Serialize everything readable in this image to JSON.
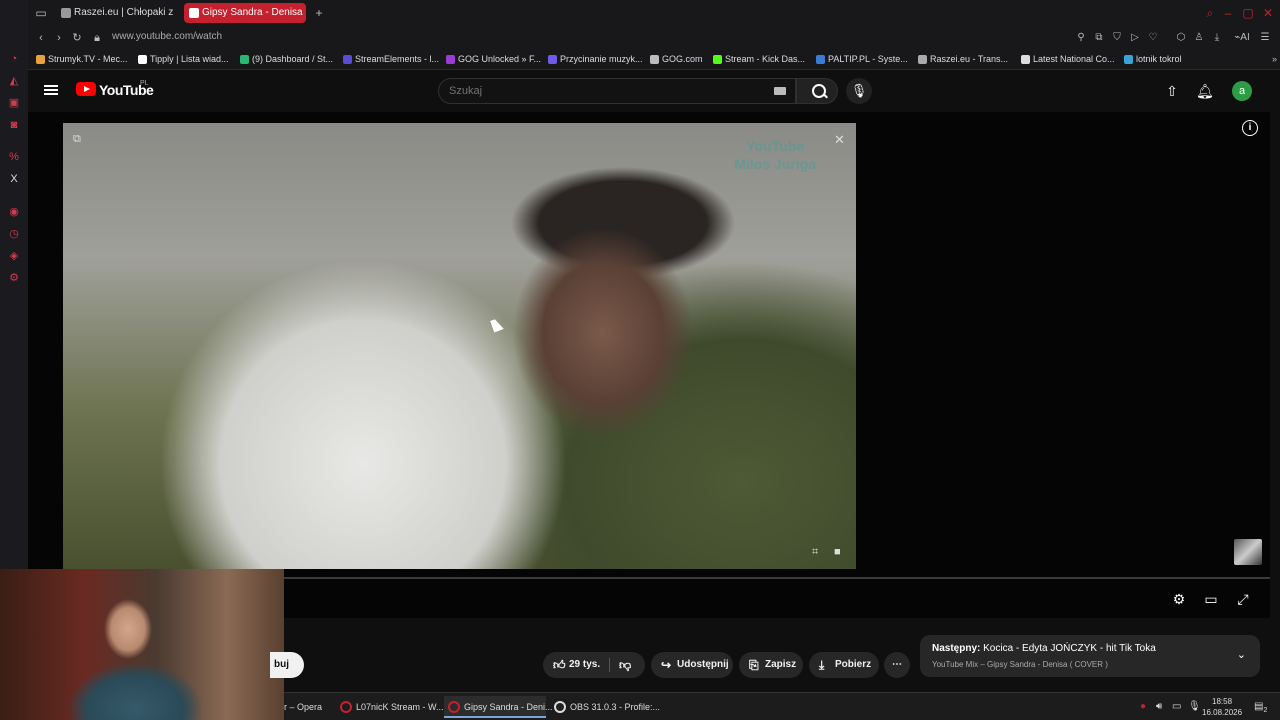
{
  "browser": {
    "tabs": [
      {
        "label": "Raszei.eu | Chłopaki z",
        "active": false
      },
      {
        "label": "Gipsy Sandra - Denisa ( CO",
        "active": true
      }
    ],
    "url": "www.youtube.com/watch",
    "ai_label": "AI",
    "bookmarks": [
      {
        "label": "Strumyk.TV - Mec...",
        "color": "#e8a33a"
      },
      {
        "label": "Tipply | Lista wiad...",
        "color": "#ffffff"
      },
      {
        "label": "(9) Dashboard / St...",
        "color": "#2bb673"
      },
      {
        "label": "StreamElements - l...",
        "color": "#5b4bd6"
      },
      {
        "label": "GOG Unlocked » F...",
        "color": "#9b3bd6"
      },
      {
        "label": "Przycinanie muzyk...",
        "color": "#6c5ce7"
      },
      {
        "label": "GOG.com",
        "color": "#bbbbbb"
      },
      {
        "label": "Stream - Kick Das...",
        "color": "#53fc18"
      },
      {
        "label": "PALTIP.PL - Syste...",
        "color": "#3b7bd6"
      },
      {
        "label": "Raszei.eu - Trans...",
        "color": "#aaaaaa"
      },
      {
        "label": "Latest National Co...",
        "color": "#dddddd"
      },
      {
        "label": "lotnik tokrol",
        "color": "#3ba3d6"
      }
    ]
  },
  "youtube": {
    "logo_text": "YouTube",
    "country": "PL",
    "search_placeholder": "Szukaj",
    "avatar_letter": "a",
    "video": {
      "watermark_line1": "YouTube",
      "watermark_line2": "Milos Juriga"
    },
    "actions": {
      "subscribe_label": "buj",
      "like_count": "29 tys.",
      "share_label": "Udostępnij",
      "save_label": "Zapisz",
      "download_label": "Pobierz"
    },
    "next": {
      "prefix": "Następny:",
      "title": "Kocica - Edyta JOŃCZYK - hit Tik Toka",
      "subtitle": "YouTube Mix – Gipsy Sandra - Denisa ( COVER )"
    }
  },
  "taskbar": {
    "items": [
      {
        "label": "r – Opera",
        "active": false
      },
      {
        "label": "L07nicK Stream - W...",
        "active": false
      },
      {
        "label": "Gipsy Sandra - Deni...",
        "active": true
      },
      {
        "label": "OBS 31.0.3 - Profile:...",
        "active": false
      }
    ],
    "time": "18:58",
    "date": "16.08.2026",
    "notifications": "2"
  }
}
